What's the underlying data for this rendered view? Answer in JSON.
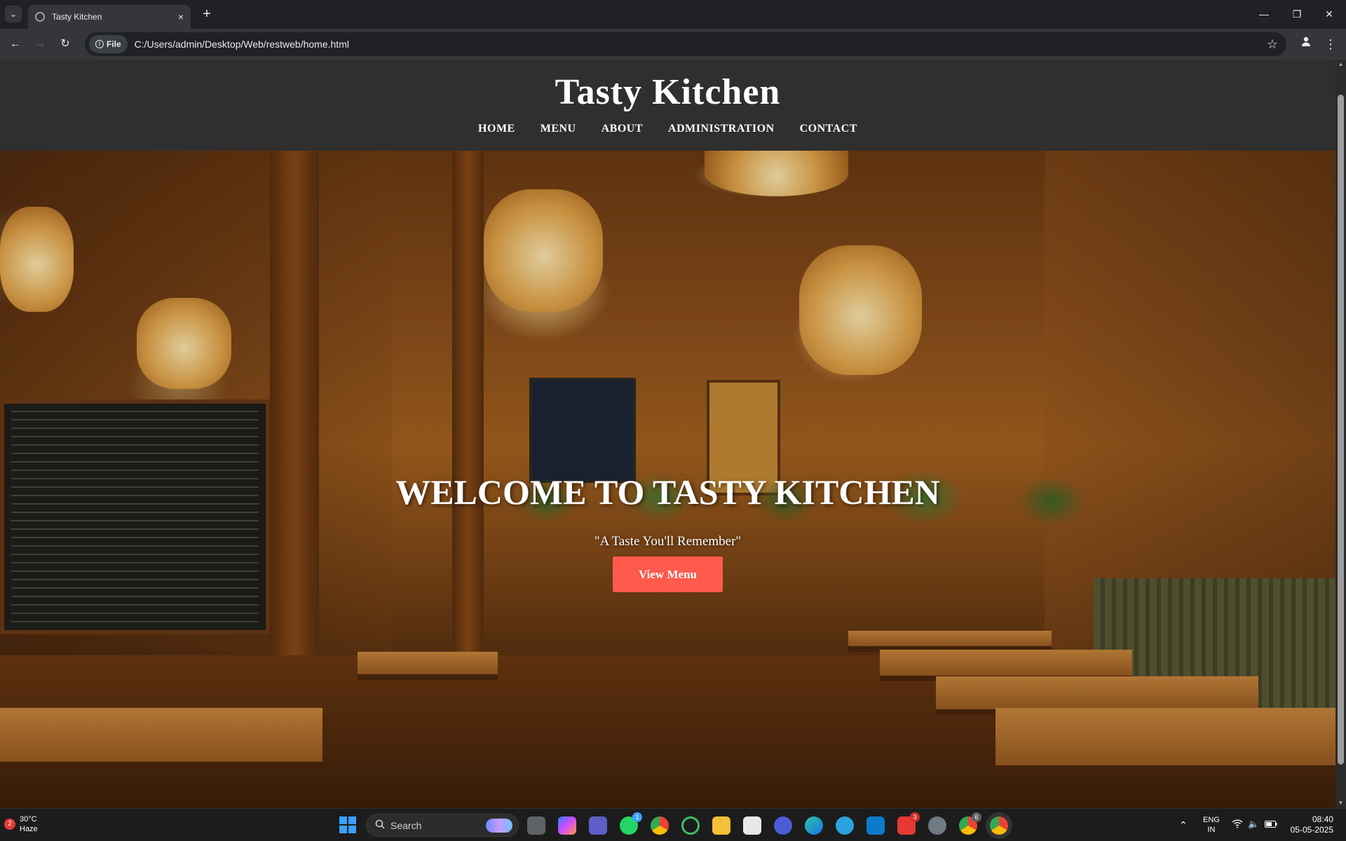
{
  "browser": {
    "tab_title": "Tasty Kitchen",
    "tab_close": "×",
    "new_tab": "+",
    "site_chip": "File",
    "url": "C:/Users/admin/Desktop/Web/restweb/home.html",
    "window_controls": {
      "minimize": "—",
      "restore": "❐",
      "close": "✕"
    }
  },
  "site": {
    "title": "Tasty Kitchen",
    "nav": [
      "HOME",
      "MENU",
      "ABOUT",
      "ADMINISTRATION",
      "CONTACT"
    ],
    "hero": {
      "heading": "WELCOME TO TASTY KITCHEN",
      "tagline": "\"A Taste You'll Remember\"",
      "button": "View Menu"
    }
  },
  "taskbar": {
    "weather_badge": "2",
    "temperature": "30°C",
    "condition": "Haze",
    "search_placeholder": "Search",
    "language_line1": "ENG",
    "language_line2": "IN",
    "time": "08:40",
    "date": "05-05-2025",
    "pinned_apps": [
      "task-view-icon",
      "copilot-icon",
      "teams-icon",
      "whatsapp-icon",
      "chrome-icon",
      "app-icon",
      "file-explorer-icon",
      "store-icon",
      "app-icon",
      "edge-icon",
      "telegram-icon",
      "vscode-icon",
      "wps-icon",
      "settings-icon",
      "chrome-icon",
      "chrome-active-icon"
    ],
    "whatsapp_badge": "1",
    "wps_badge": "3",
    "chrome_badge": "6"
  },
  "colors": {
    "header_bg": "#2f2f2f",
    "button_bg": "#ff5a4b",
    "browser_bg": "#202124"
  }
}
